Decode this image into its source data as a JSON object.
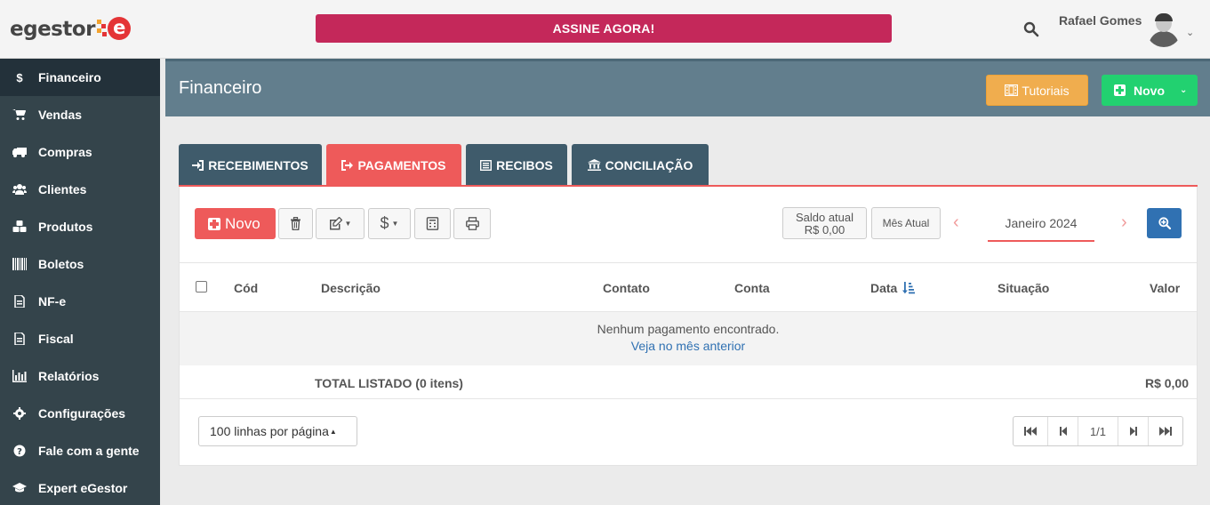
{
  "topbar": {
    "logo_text": "egestor",
    "logo_mark": "e",
    "cta_label": "ASSINE AGORA!",
    "user_name": "Rafael Gomes",
    "colors": {
      "cta": "#c4285a",
      "logo_red": "#e43436"
    }
  },
  "sidebar": {
    "items": [
      {
        "label": "Financeiro",
        "icon": "dollar-icon",
        "active": true
      },
      {
        "label": "Vendas",
        "icon": "cart-icon"
      },
      {
        "label": "Compras",
        "icon": "truck-icon"
      },
      {
        "label": "Clientes",
        "icon": "users-icon"
      },
      {
        "label": "Produtos",
        "icon": "cubes-icon"
      },
      {
        "label": "Boletos",
        "icon": "barcode-icon"
      },
      {
        "label": "NF-e",
        "icon": "document-icon"
      },
      {
        "label": "Fiscal",
        "icon": "document-icon"
      },
      {
        "label": "Relatórios",
        "icon": "bar-chart-icon"
      },
      {
        "label": "Configurações",
        "icon": "gear-icon"
      },
      {
        "label": "Fale com a gente",
        "icon": "question-icon"
      },
      {
        "label": "Expert eGestor",
        "icon": "graduation-cap-icon"
      }
    ]
  },
  "header": {
    "title": "Financeiro",
    "tutorials_label": "Tutoriais",
    "new_label": "Novo"
  },
  "tabs": [
    {
      "label": "RECEBIMENTOS",
      "icon": "sign-in-icon"
    },
    {
      "label": "PAGAMENTOS",
      "icon": "sign-out-icon",
      "active": true
    },
    {
      "label": "RECIBOS",
      "icon": "receipt-icon"
    },
    {
      "label": "CONCILIAÇÃO",
      "icon": "bank-icon"
    }
  ],
  "toolbar": {
    "new_label": "Novo",
    "balance_label": "Saldo atual",
    "balance_value": "R$ 0,00",
    "current_month_label": "Mês Atual",
    "month": "Janeiro 2024",
    "prev": "‹",
    "next": "›"
  },
  "table": {
    "columns": [
      "Cód",
      "Descrição",
      "Contato",
      "Conta",
      "Data",
      "Situação",
      "Valor"
    ],
    "empty_message": "Nenhum pagamento encontrado.",
    "empty_link": "Veja no mês anterior",
    "total_label": "TOTAL LISTADO (0 itens)",
    "total_value": "R$ 0,00"
  },
  "pagination": {
    "per_page": "100 linhas por página",
    "page_indicator": "1/1"
  }
}
